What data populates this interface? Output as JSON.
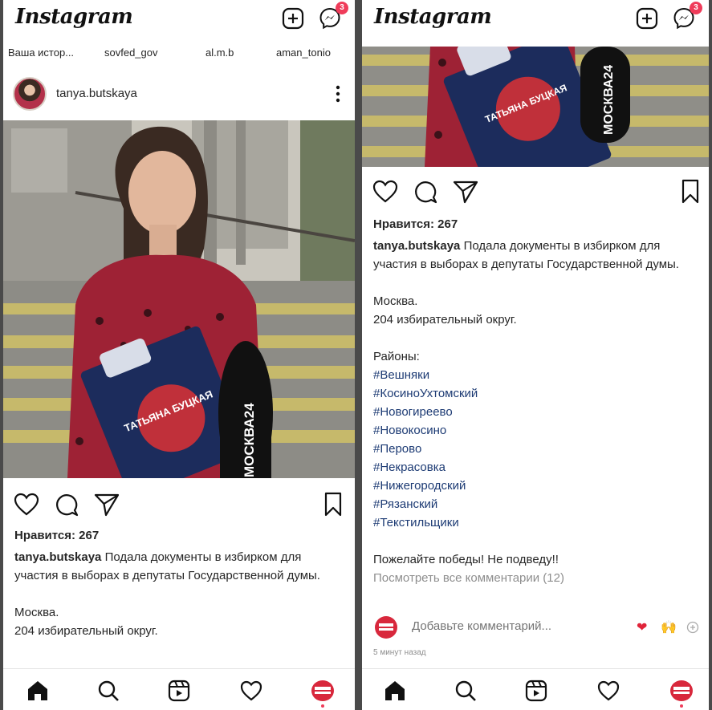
{
  "app": {
    "logo": "Instagram",
    "messages_badge": "3"
  },
  "stories": [
    "Ваша истор...",
    "sovfed_gov",
    "al.m.b",
    "aman_tonio"
  ],
  "post": {
    "username": "tanya.butskaya",
    "photo_text": {
      "clipboard": "ТАТЬЯНА БУЦКАЯ",
      "microphone": "МОСКВА24"
    },
    "likes": "Нравится: 267",
    "caption_intro": "Подала документы в избирком для участия в выборах в депутаты Государственной думы.",
    "city": "Москва.",
    "district": "204 избирательный округ.",
    "districts_heading": "Районы:",
    "hashtags": [
      "#Вешняки",
      "#КосиноУхтомский",
      "#Новогиреево",
      "#Новокосино",
      "#Перово",
      "#Некрасовка",
      "#Нижегородский",
      "#Рязанский",
      "#Текстильщики"
    ],
    "closing": "Пожелайте победы! Не подведу!!",
    "view_comments": "Посмотреть все комментарии (12)",
    "comment_placeholder": "Добавьте комментарий...",
    "quick_reactions": [
      "❤",
      "🙌"
    ],
    "time_ago": "5 минут назад"
  },
  "colors": {
    "badge": "#ef3c5a",
    "hashtag": "#1d3b74",
    "heart": "#e0243a"
  },
  "nav_icons": [
    "home-icon",
    "search-icon",
    "reels-icon",
    "activity-heart-icon",
    "profile-avatar"
  ]
}
